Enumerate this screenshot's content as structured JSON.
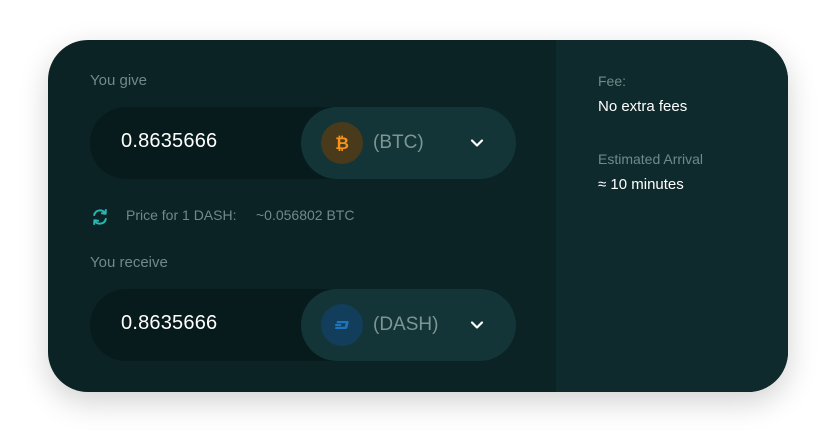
{
  "give": {
    "label": "You give",
    "amount": "0.8635666",
    "ticker": "(BTC)",
    "icon": "bitcoin-icon",
    "icon_color": "#f7931a"
  },
  "rate": {
    "label": "Price for 1 DASH:",
    "value": "~0.056802 BTC",
    "icon": "swap-icon",
    "icon_color": "#2bb5b0"
  },
  "receive": {
    "label": "You receive",
    "amount": "0.8635666",
    "ticker": "(DASH)",
    "icon": "dash-icon",
    "icon_color": "#1c75bc"
  },
  "info": {
    "fee_label": "Fee:",
    "fee_value": "No extra fees",
    "eta_label": "Estimated Arrival",
    "eta_value": "≈ 10 minutes"
  },
  "colors": {
    "card_bg": "#0b2325",
    "panel_bg": "#0e2a2c",
    "pill_bg": "#071b1c",
    "selector_bg": "#143537"
  }
}
